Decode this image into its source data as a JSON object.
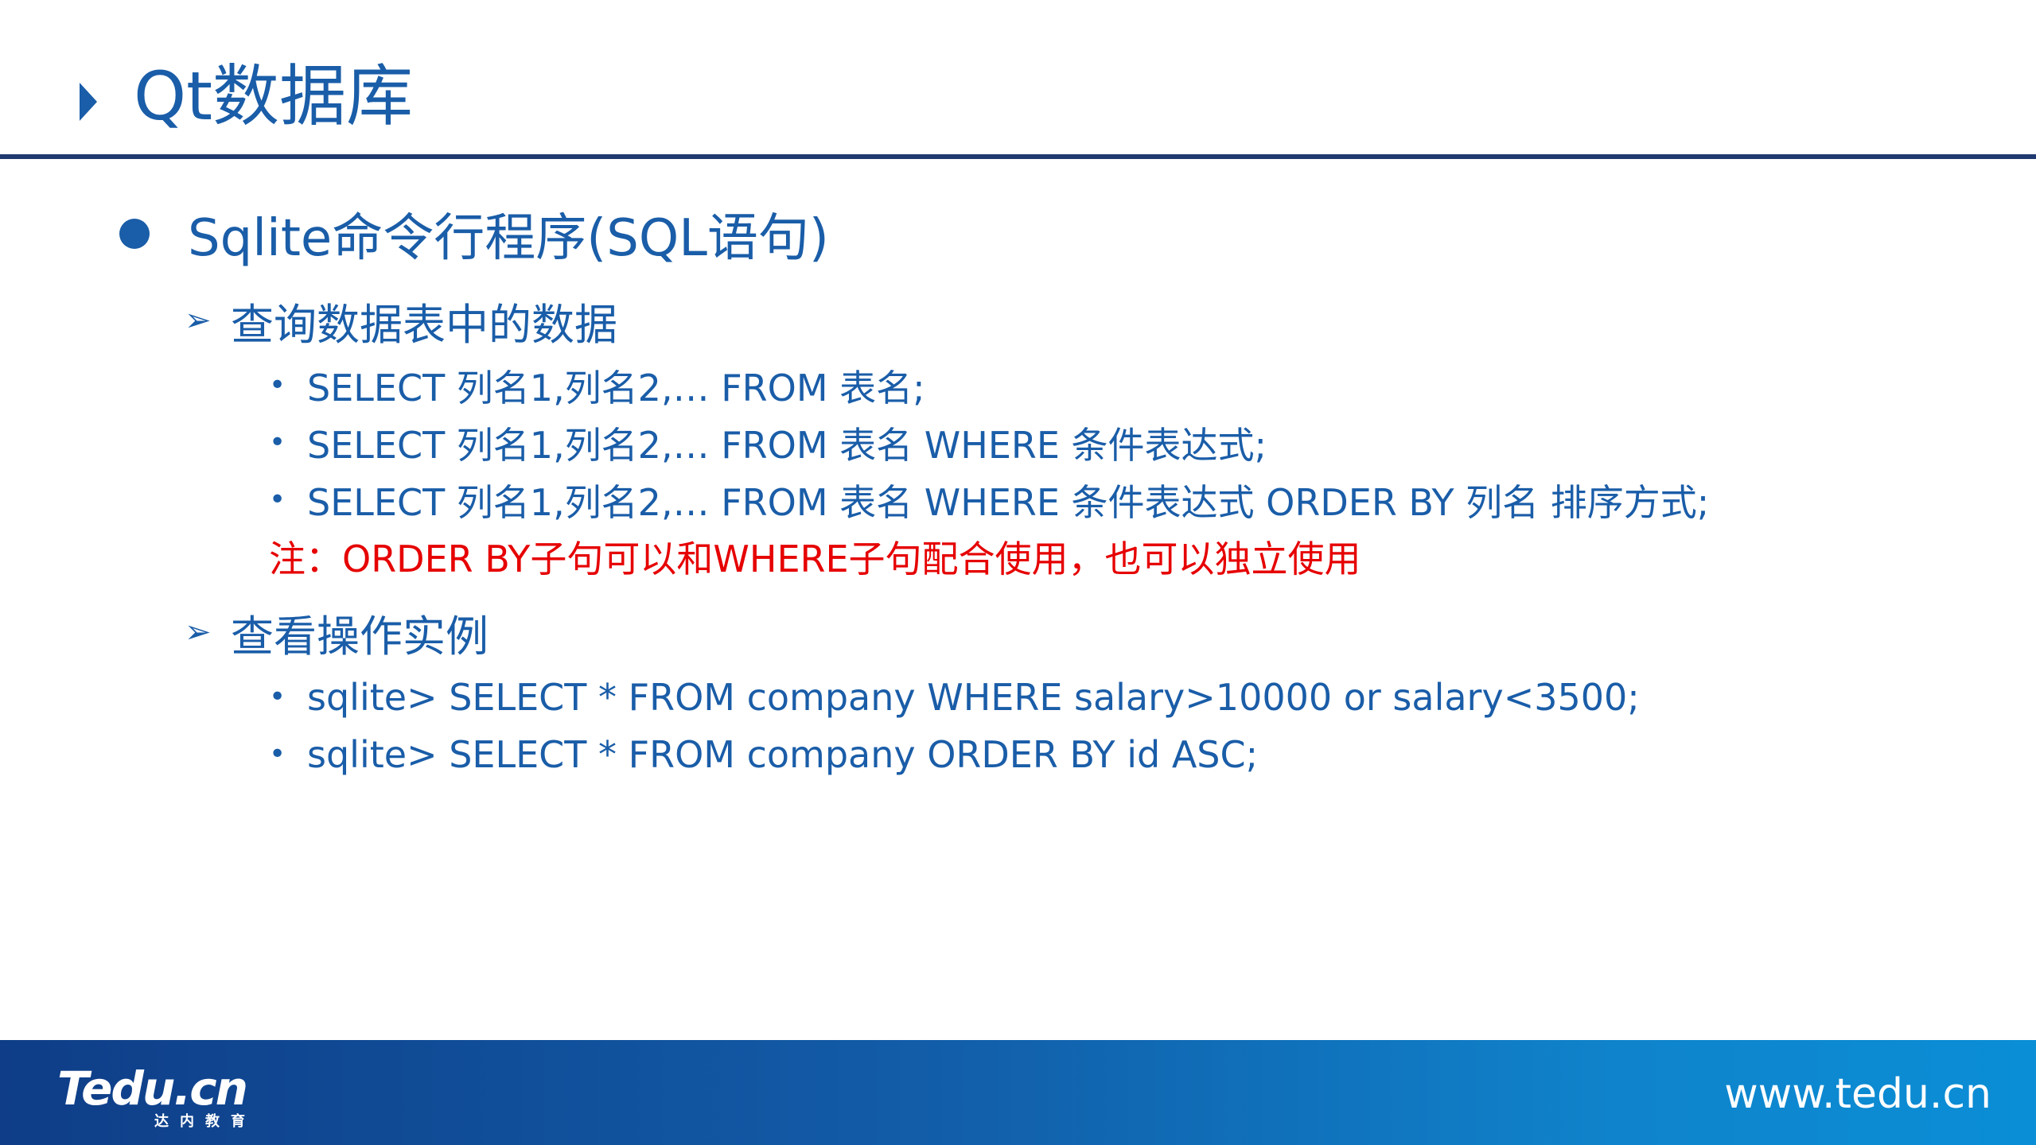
{
  "slide": {
    "title": "Qt数据库",
    "level1": "Sqlite命令行程序(SQL语句)",
    "sections": [
      {
        "heading": "查询数据表中的数据",
        "items": [
          "SELECT 列名1,列名2,…  FROM 表名;",
          "SELECT 列名1,列名2,…  FROM 表名 WHERE 条件表达式;",
          "SELECT 列名1,列名2,…  FROM 表名 WHERE 条件表达式  ORDER BY 列名 排序方式;"
        ],
        "note": "注：ORDER BY子句可以和WHERE子句配合使用，也可以独立使用"
      },
      {
        "heading": "查看操作实例",
        "items": [
          "sqlite> SELECT * FROM company  WHERE salary>10000 or salary<3500;",
          "sqlite> SELECT * FROM company  ORDER BY id ASC;"
        ]
      }
    ]
  },
  "footer": {
    "logo_main": "Tedu.cn",
    "logo_sub": "达内教育",
    "website": "www.tedu.cn"
  },
  "icons": {
    "title_marker": "triangle-right-icon",
    "level1_bullet": "filled-circle-icon",
    "level2_bullet": "arrow-right-icon",
    "level3_bullet": "small-dot-icon"
  },
  "colors": {
    "text_blue": "#1a5da8",
    "note_red": "#e60000",
    "rule": "#1f3a70",
    "footer_start": "#0f3d87",
    "footer_end": "#0a8ed6"
  }
}
